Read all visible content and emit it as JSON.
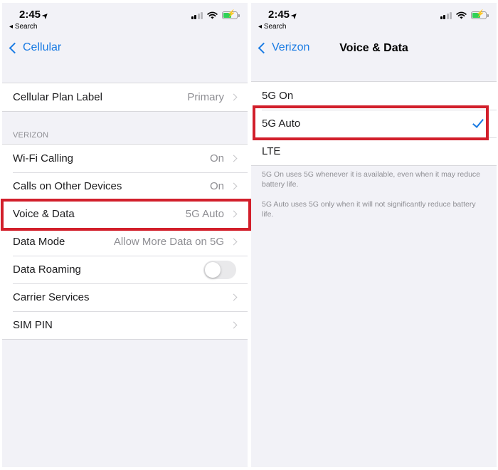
{
  "left": {
    "status": {
      "time": "2:45",
      "back_app": "Search"
    },
    "nav": {
      "back_label": "Cellular"
    },
    "plan_row": {
      "label": "Cellular Plan Label",
      "value": "Primary"
    },
    "section_header": "VERIZON",
    "rows": [
      {
        "label": "Wi-Fi Calling",
        "value": "On"
      },
      {
        "label": "Calls on Other Devices",
        "value": "On"
      },
      {
        "label": "Voice & Data",
        "value": "5G Auto"
      },
      {
        "label": "Data Mode",
        "value": "Allow More Data on 5G"
      },
      {
        "label": "Data Roaming",
        "toggle_on": false
      },
      {
        "label": "Carrier Services"
      },
      {
        "label": "SIM PIN"
      }
    ]
  },
  "right": {
    "status": {
      "time": "2:45",
      "back_app": "Search"
    },
    "nav": {
      "back_label": "Verizon",
      "title": "Voice & Data"
    },
    "options": [
      {
        "label": "5G On",
        "selected": false
      },
      {
        "label": "5G Auto",
        "selected": true
      },
      {
        "label": "LTE",
        "selected": false
      }
    ],
    "footnotes": [
      "5G On uses 5G whenever it is available, even when it may reduce battery life.",
      "5G Auto uses 5G only when it will not significantly reduce battery life."
    ]
  },
  "colors": {
    "accent": "#1a7be3",
    "highlight": "#d21f2b",
    "background": "#f2f2f7",
    "battery": "#30d158"
  }
}
